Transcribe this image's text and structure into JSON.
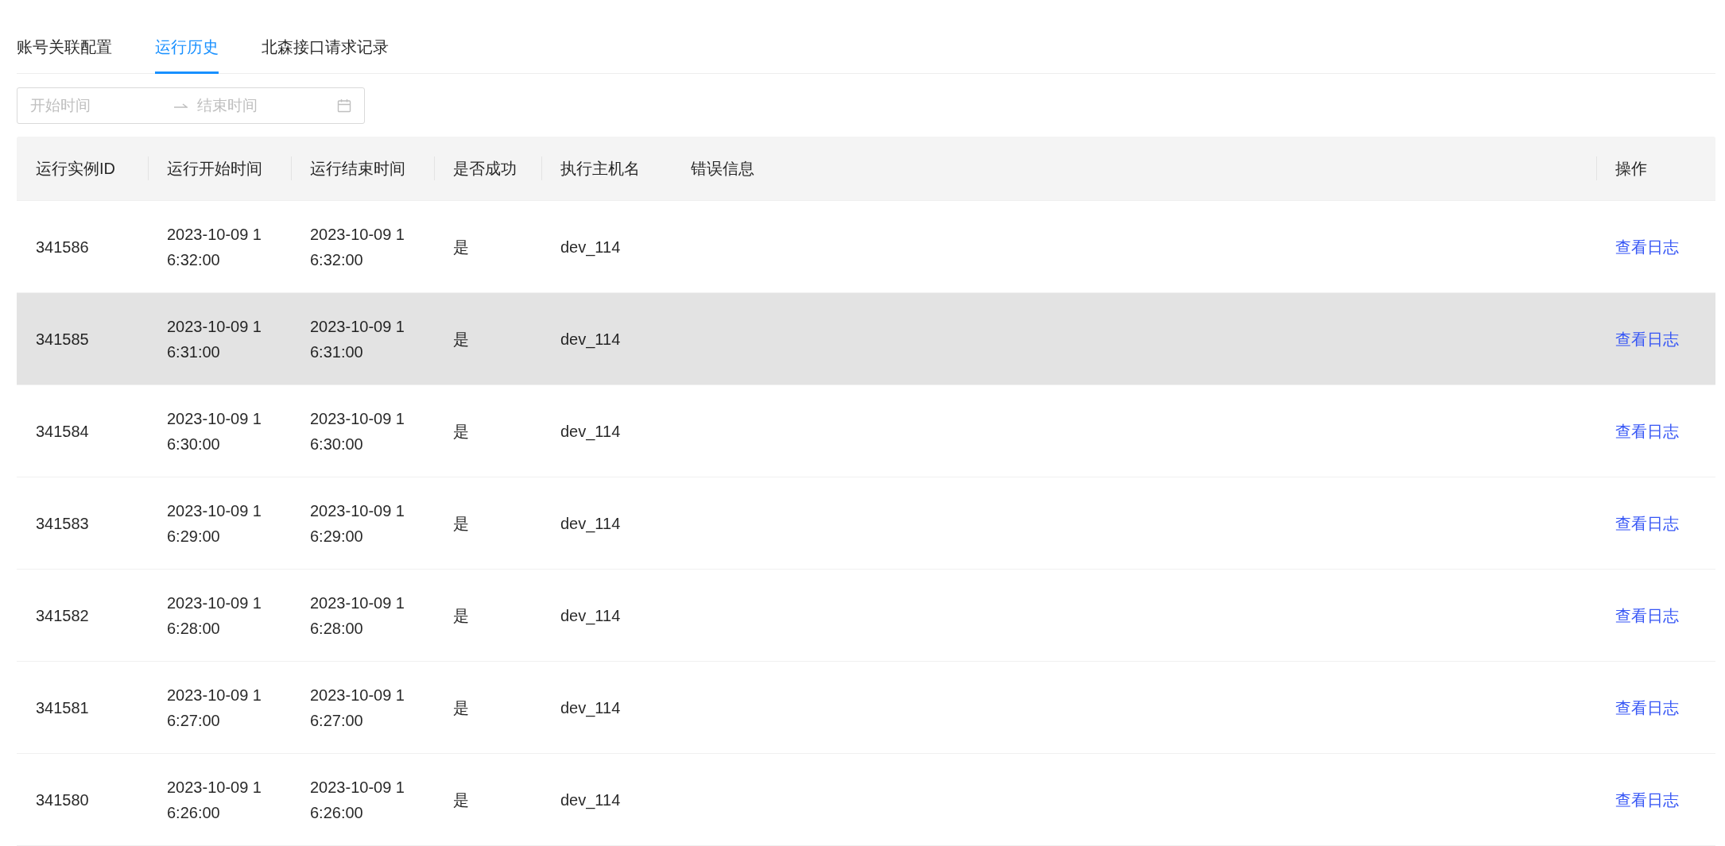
{
  "tabs": [
    {
      "label": "账号关联配置",
      "selected": false
    },
    {
      "label": "运行历史",
      "selected": true
    },
    {
      "label": "北森接口请求记录",
      "selected": false
    }
  ],
  "date_range": {
    "start_placeholder": "开始时间",
    "end_placeholder": "结束时间"
  },
  "table": {
    "columns": [
      "运行实例ID",
      "运行开始时间",
      "运行结束时间",
      "是否成功",
      "执行主机名",
      "错误信息",
      "操作"
    ],
    "rows": [
      {
        "id": "341586",
        "start": "2023-10-09 16:32:00",
        "end": "2023-10-09 16:32:00",
        "success": "是",
        "host": "dev_114",
        "action": "查看日志",
        "hovered": false
      },
      {
        "id": "341585",
        "start": "2023-10-09 16:31:00",
        "end": "2023-10-09 16:31:00",
        "success": "是",
        "host": "dev_114",
        "action": "查看日志",
        "hovered": true
      },
      {
        "id": "341584",
        "start": "2023-10-09 16:30:00",
        "end": "2023-10-09 16:30:00",
        "success": "是",
        "host": "dev_114",
        "action": "查看日志",
        "hovered": false
      },
      {
        "id": "341583",
        "start": "2023-10-09 16:29:00",
        "end": "2023-10-09 16:29:00",
        "success": "是",
        "host": "dev_114",
        "action": "查看日志",
        "hovered": false
      },
      {
        "id": "341582",
        "start": "2023-10-09 16:28:00",
        "end": "2023-10-09 16:28:00",
        "success": "是",
        "host": "dev_114",
        "action": "查看日志",
        "hovered": false
      },
      {
        "id": "341581",
        "start": "2023-10-09 16:27:00",
        "end": "2023-10-09 16:27:00",
        "success": "是",
        "host": "dev_114",
        "action": "查看日志",
        "hovered": false
      },
      {
        "id": "341580",
        "start": "2023-10-09 16:26:00",
        "end": "2023-10-09 16:26:00",
        "success": "是",
        "host": "dev_114",
        "action": "查看日志",
        "hovered": false
      }
    ]
  }
}
